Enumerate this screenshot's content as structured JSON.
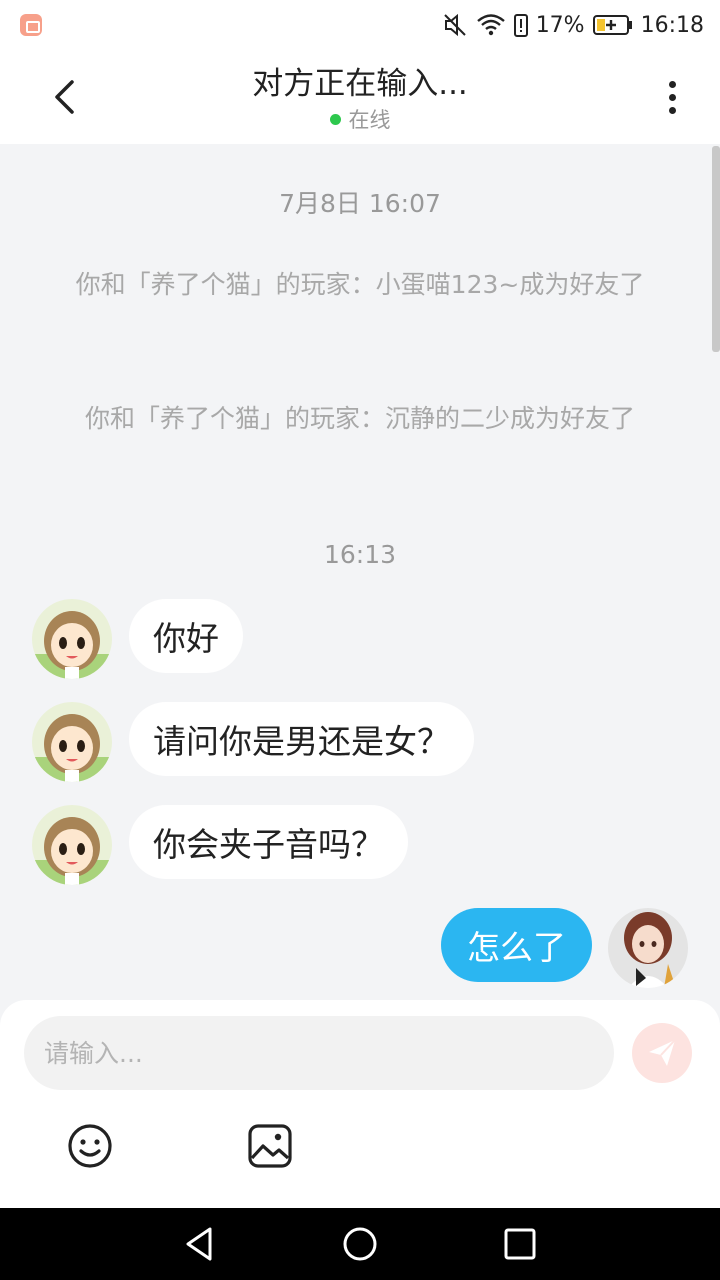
{
  "status_bar": {
    "battery_percent": "17%",
    "time": "16:18",
    "icons": [
      "app-notification-icon",
      "mute-icon",
      "wifi-icon",
      "battery-alert-icon",
      "battery-charging-icon"
    ]
  },
  "header": {
    "title": "对方正在输入...",
    "status": "在线",
    "status_color": "#2dc84d"
  },
  "chat": {
    "timestamps": [
      "7月8日 16:07",
      "16:13"
    ],
    "system_messages": [
      "你和「养了个猫」的玩家：小蛋喵123~成为好友了",
      "你和「养了个猫」的玩家：沉静的二少成为好友了"
    ],
    "messages": [
      {
        "side": "left",
        "text": "你好"
      },
      {
        "side": "left",
        "text": "请问你是男还是女？"
      },
      {
        "side": "left",
        "text": "你会夹子音吗？"
      },
      {
        "side": "right",
        "text": "怎么了"
      }
    ]
  },
  "input": {
    "placeholder": "请输入..."
  },
  "colors": {
    "accent": "#2bb6f1",
    "send_button_bg": "#fde3e0",
    "background": "#f3f4f6"
  }
}
